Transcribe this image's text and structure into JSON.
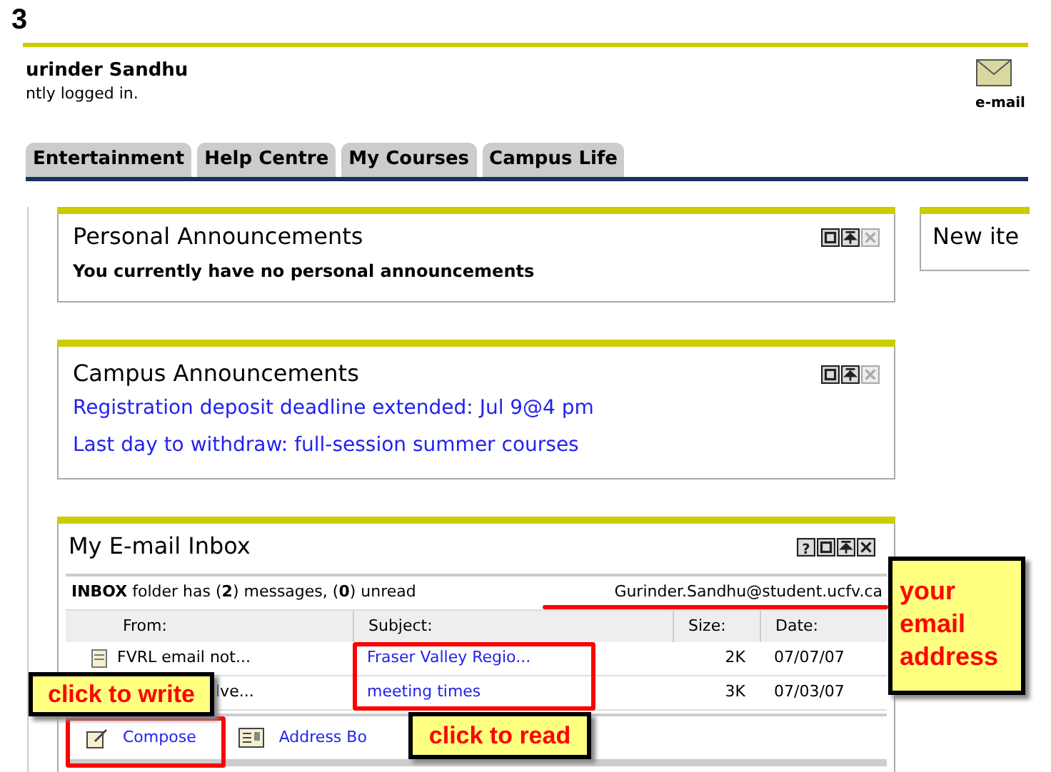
{
  "step_number": "3",
  "user": {
    "name": "urinder Sandhu",
    "status": "ntly logged in."
  },
  "email_link": {
    "label": "e-mail"
  },
  "tabs": [
    {
      "label": "Entertainment",
      "selected": false
    },
    {
      "label": "Help Centre",
      "selected": false
    },
    {
      "label": "My Courses",
      "selected": false
    },
    {
      "label": "Campus Life",
      "selected": false
    }
  ],
  "personal_announcements": {
    "title": "Personal Announcements",
    "controls": [
      {
        "kind": "restore",
        "disabled": false
      },
      {
        "kind": "top",
        "disabled": false
      },
      {
        "kind": "close",
        "disabled": true
      }
    ],
    "message": "You currently have no personal announcements"
  },
  "campus_announcements": {
    "title": "Campus Announcements",
    "controls": [
      {
        "kind": "restore",
        "disabled": false
      },
      {
        "kind": "top",
        "disabled": false
      },
      {
        "kind": "close",
        "disabled": true
      }
    ],
    "links": [
      "Registration deposit deadline extended: Jul 9@4 pm",
      "Last day to withdraw: full-session summer courses"
    ]
  },
  "inbox": {
    "title": "My E-mail Inbox",
    "controls": [
      {
        "kind": "help",
        "symbol": "?",
        "disabled": false
      },
      {
        "kind": "restore",
        "disabled": false
      },
      {
        "kind": "top",
        "disabled": false
      },
      {
        "kind": "close",
        "disabled": false
      }
    ],
    "summary": "**INBOX** folder has (**2**) messages, (**0**) unread",
    "address": "Gurinder.Sandhu@student.ucfv.ca",
    "columns": [
      "From:",
      "Subject:",
      "Size:",
      "Date:"
    ],
    "rows": [
      {
        "from": "FVRL email not...",
        "subject": "Fraser Valley Regio...",
        "size": "2K",
        "date": "07/07/07",
        "icon": true
      },
      {
        "from": "lve...",
        "subject": "meeting times",
        "size": "3K",
        "date": "07/03/07",
        "icon": false
      }
    ],
    "actions": [
      "Compose",
      "Address Bo"
    ]
  },
  "side_panel": {
    "title": "New ite"
  },
  "annotations": {
    "address_note": "your email address",
    "write_note": "click to write",
    "read_note": "click to read"
  }
}
